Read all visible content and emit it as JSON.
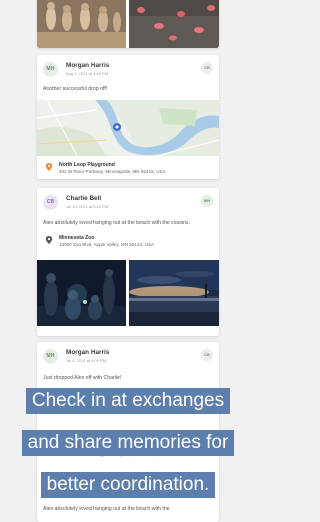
{
  "posts": [
    {
      "avatar": "MH",
      "name": "Morgan Harris",
      "time": "Aug 1, 2021 at 4:00 PM",
      "badge": "CB",
      "message": "Another successful drop off!",
      "location_name": "North Loop Playground",
      "location_address": "402 W River Parkway, Minneapolis, MN 55415, USA",
      "pin_color": "#e8893a"
    },
    {
      "avatar": "CB",
      "name": "Charlie Bell",
      "time": "Jul 15, 2021 at 6:14 PM",
      "badge": "MH",
      "message": "Alex absolutely loved hanging out at the beach with the cousins.",
      "location_name": "Minnesota Zoo",
      "location_address": "13000 Zoo Blvd, Apple Valley, MN 55124, USA",
      "pin_color": "#555555"
    },
    {
      "avatar": "MH",
      "name": "Morgan Harris",
      "time": "Jul 8, 2021 at 4:00 PM",
      "badge": "CB",
      "message": "Just dropped Alex off with Charlie!",
      "partial_address": "402 W River Parkway, Minneapolis, MN 55415, USA",
      "partial_message": "Alex absolutely loved hanging out at the beach with the"
    }
  ],
  "banner": {
    "line1": "Check in at exchanges",
    "line2": "and share memories for",
    "line3": "better coordination."
  },
  "colors": {
    "banner": "#5d7fae",
    "accent_green": "#6a8b6a",
    "accent_purple": "#8d6fab"
  }
}
